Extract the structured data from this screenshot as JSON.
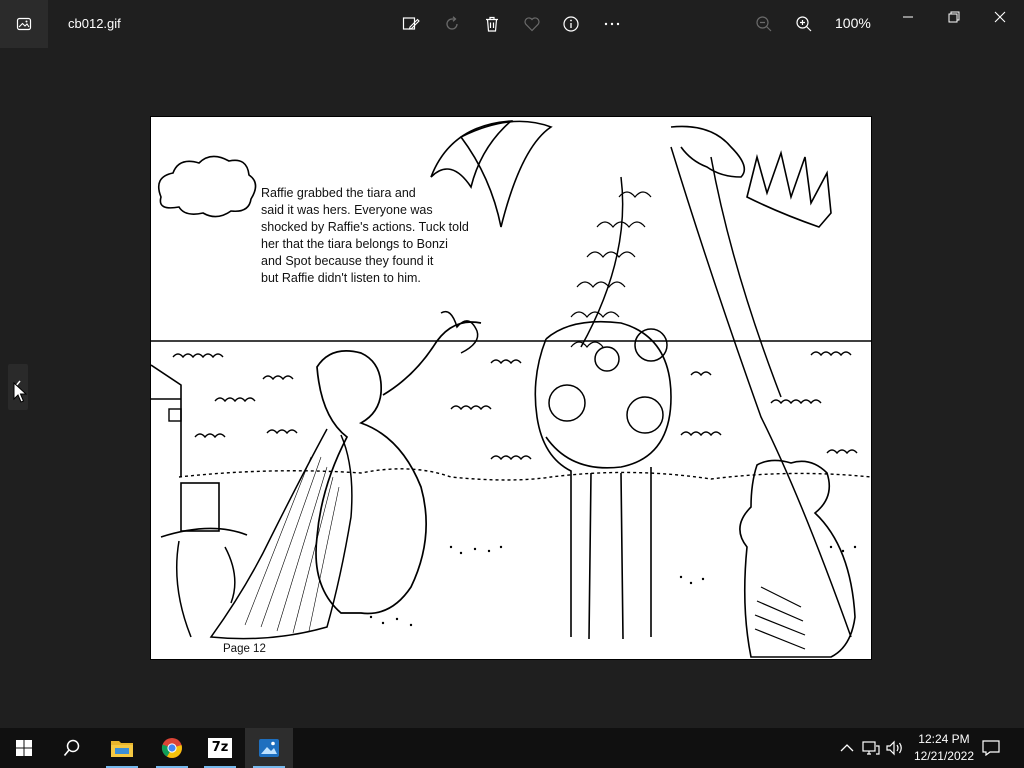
{
  "window": {
    "filename": "cb012.gif",
    "zoom_level": "100%"
  },
  "toolbar": {
    "icons": [
      "edit-image-icon",
      "rotate-icon",
      "delete-icon",
      "favorite-icon",
      "info-icon",
      "more-icon",
      "zoom-out-icon",
      "zoom-in-icon"
    ]
  },
  "image": {
    "caption_lines": [
      "Raffie grabbed the tiara and",
      "said it was hers. Everyone was",
      "shocked by Raffie's actions. Tuck told",
      "her that the tiara belongs to Bonzi",
      "and Spot because they found it",
      "but Raffie didn't listen to him."
    ],
    "page_label": "Page 12"
  },
  "taskbar": {
    "apps": [
      "start",
      "search",
      "file-explorer",
      "chrome",
      "7-zip",
      "photos"
    ],
    "seven_zip_label": "7z",
    "time": "12:24 PM",
    "date": "12/21/2022"
  }
}
